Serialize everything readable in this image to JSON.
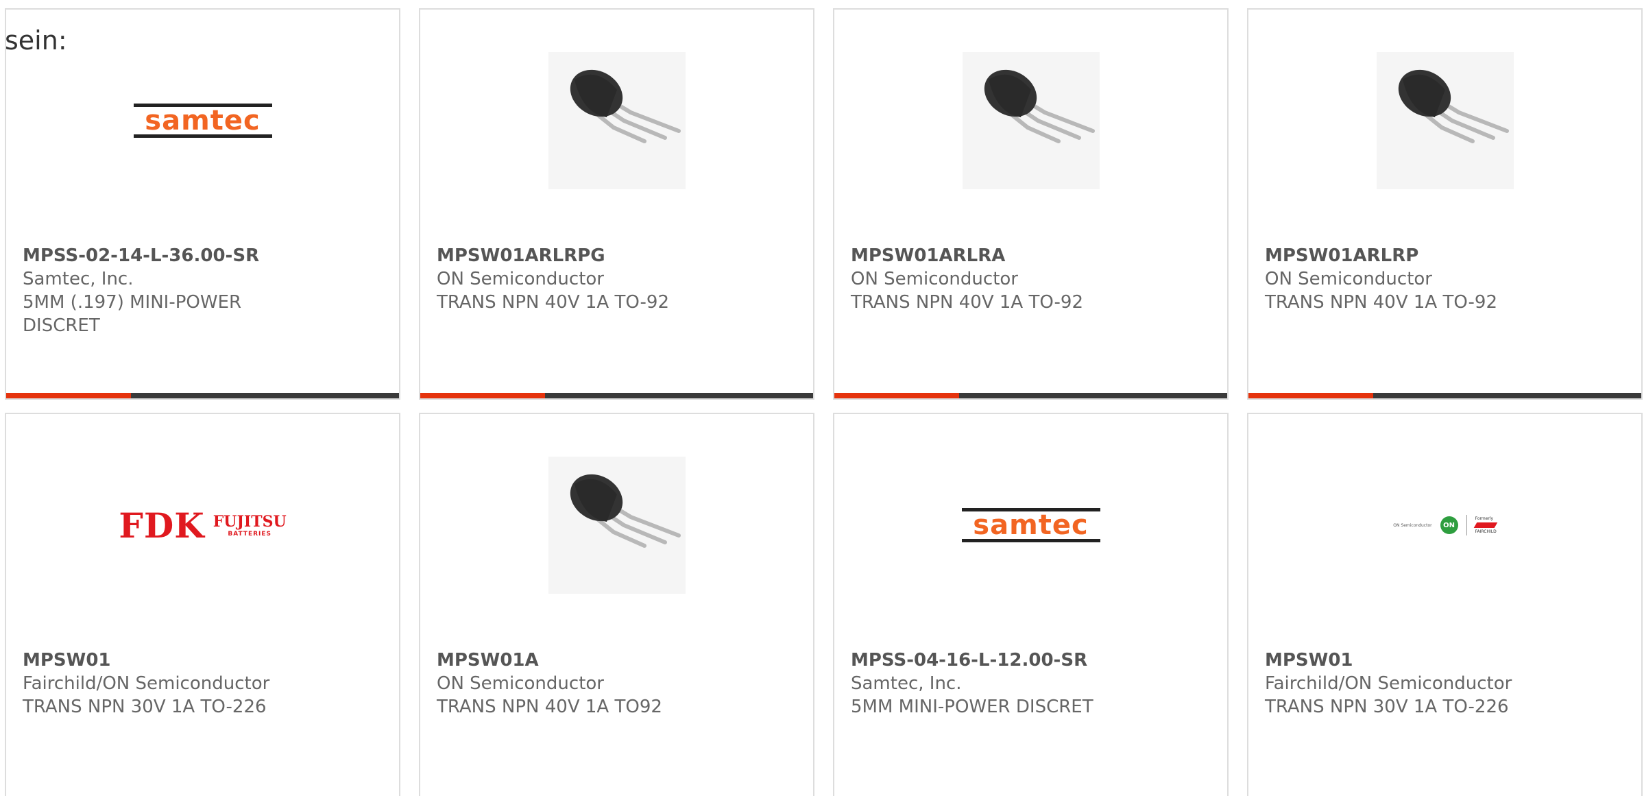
{
  "lead_text": "sein:",
  "colors": {
    "accent": "#e5330d",
    "bar_dark": "#3a3a3a",
    "card_border": "#dddddd",
    "text": "#666666",
    "samtec_orange": "#f26522",
    "fdk_red": "#e0191f",
    "on_green": "#2e9e3f"
  },
  "logos": {
    "samtec": "samtec",
    "fdk": "FDK",
    "fdk_fujitsu": "FUJITSU",
    "fdk_batteries": "BATTERIES",
    "fairchild_on_semi": "ON Semiconductor",
    "fairchild_on": "ON",
    "fairchild_formerly": "Formerly",
    "fairchild_name": "FAIRCHILD"
  },
  "cards": [
    {
      "image": "samtec-logo",
      "part_number": "MPSS-02-14-L-36.00-SR",
      "manufacturer": "Samtec, Inc.",
      "description": "5MM (.197) MINI-POWER DISCRET"
    },
    {
      "image": "transistor-to92",
      "part_number": "MPSW01ARLRPG",
      "manufacturer": "ON Semiconductor",
      "description": "TRANS NPN 40V 1A TO-92"
    },
    {
      "image": "transistor-to92",
      "part_number": "MPSW01ARLRA",
      "manufacturer": "ON Semiconductor",
      "description": "TRANS NPN 40V 1A TO-92"
    },
    {
      "image": "transistor-to92",
      "part_number": "MPSW01ARLRP",
      "manufacturer": "ON Semiconductor",
      "description": "TRANS NPN 40V 1A TO-92"
    },
    {
      "image": "fdk-logo",
      "part_number": "MPSW01",
      "manufacturer": "Fairchild/ON Semiconductor",
      "description": "TRANS NPN 30V 1A TO-226"
    },
    {
      "image": "transistor-to92",
      "part_number": "MPSW01A",
      "manufacturer": "ON Semiconductor",
      "description": "TRANS NPN 40V 1A TO92"
    },
    {
      "image": "samtec-logo",
      "part_number": "MPSS-04-16-L-12.00-SR",
      "manufacturer": "Samtec, Inc.",
      "description": "5MM MINI-POWER DISCRET"
    },
    {
      "image": "fairchild-on-logo",
      "part_number": "MPSW01",
      "manufacturer": "Fairchild/ON Semiconductor",
      "description": "TRANS NPN 30V 1A TO-226"
    }
  ]
}
